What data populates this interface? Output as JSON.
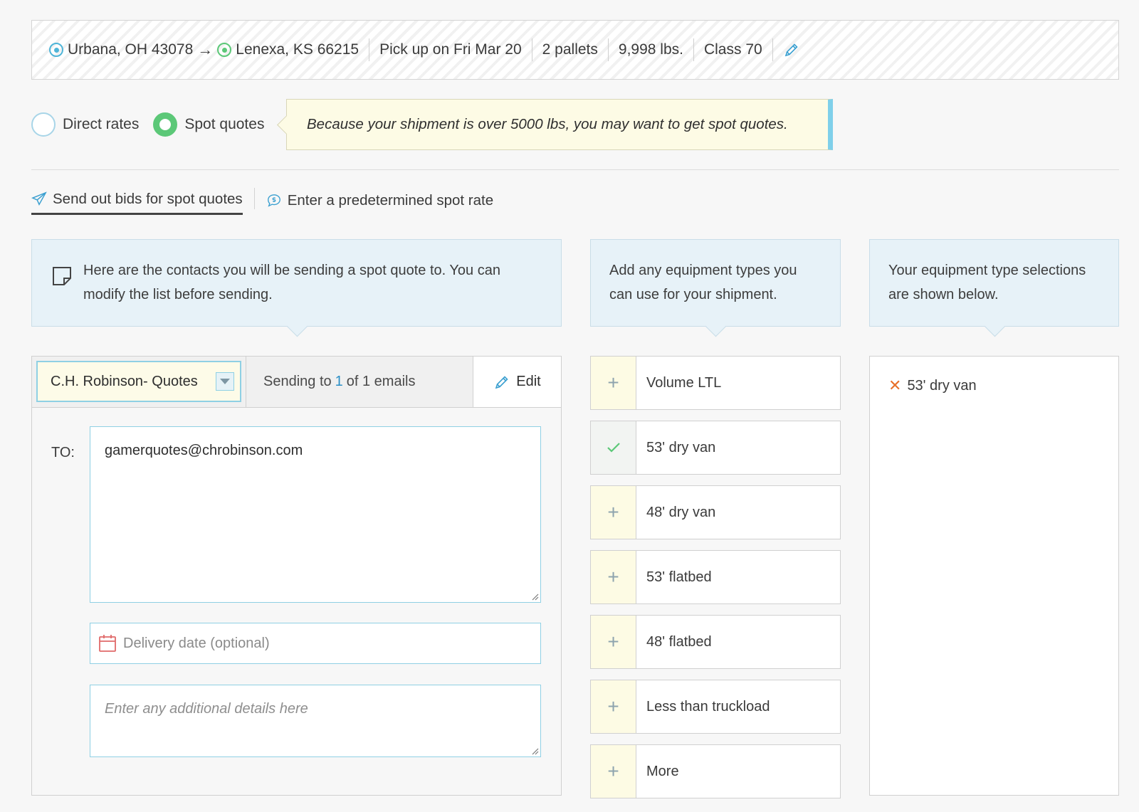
{
  "summary": {
    "origin": "Urbana, OH 43078",
    "arrow": "→",
    "destination": "Lenexa, KS 66215",
    "pickup": "Pick up on Fri Mar 20",
    "pallets": "2 pallets",
    "weight": "9,998 lbs.",
    "freight_class": "Class 70",
    "edit_icon": "pencil-icon"
  },
  "rate_options": {
    "direct_label": "Direct rates",
    "spot_label": "Spot quotes",
    "selected": "Spot quotes"
  },
  "tip": {
    "text": "Because your shipment is over 5000 lbs, you may want to get spot quotes."
  },
  "tabs": [
    {
      "label": "Send out bids for spot quotes",
      "icon": "paper-plane-icon",
      "active": true
    },
    {
      "label": "Enter a predetermined spot rate",
      "icon": "dollar-chat-icon",
      "active": false
    }
  ],
  "info": {
    "contacts": "Here are the contacts you will be sending a spot quote to. You can modify the list before sending.",
    "equipment": "Add any equipment types you can use for your shipment.",
    "selections": "Your equipment type selections are shown below."
  },
  "contacts": {
    "carrier_select": "C.H. Robinson- Quotes",
    "sending_prefix": "Sending to",
    "sending_count": "1",
    "sending_suffix": "of 1 emails",
    "edit_label": "Edit",
    "to_label": "TO:",
    "to_value": "gamerquotes@chrobinson.com",
    "delivery_placeholder": "Delivery date (optional)",
    "details_placeholder": "Enter any additional details here"
  },
  "equipment": [
    {
      "label": "Volume LTL",
      "selected": false
    },
    {
      "label": "53' dry van",
      "selected": true
    },
    {
      "label": "48' dry van",
      "selected": false
    },
    {
      "label": "53' flatbed",
      "selected": false
    },
    {
      "label": "48' flatbed",
      "selected": false
    },
    {
      "label": "Less than truckload",
      "selected": false
    },
    {
      "label": "More",
      "selected": false
    }
  ],
  "selections": [
    {
      "label": "53' dry van"
    }
  ],
  "colors": {
    "accent_blue": "#4fb5d8",
    "accent_green": "#5cc878",
    "remove_orange": "#e8702a",
    "info_bg": "#e7f2f8",
    "tip_bg": "#fdfbe5"
  }
}
